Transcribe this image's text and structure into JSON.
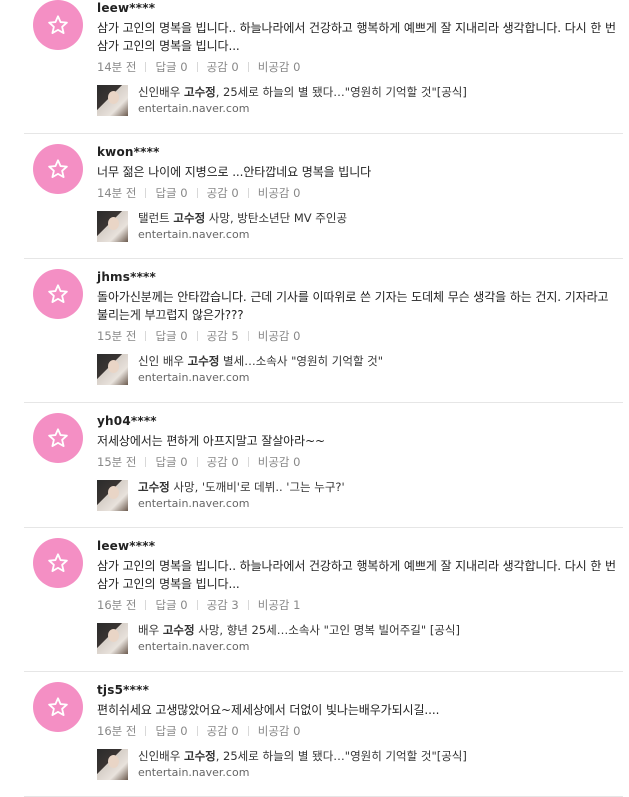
{
  "comments": [
    {
      "user": "leew****",
      "text": "삼가 고인의 명복을 빕니다.. 하늘나라에서 건강하고 행복하게 예쁘게 잘 지내리라 생각합니다. 다시 한 번 삼가 고인의 명복을 빕니다...",
      "time": "14분 전",
      "reply": "답글 0",
      "like": "공감 0",
      "dislike": "비공감 0",
      "article_pre": "신인배우 ",
      "article_name": "고수정",
      "article_post": ", 25세로 하늘의 별 됐다…\"영원히 기억할 것\"[공식]",
      "source": "entertain.naver.com"
    },
    {
      "user": "kwon****",
      "text": "너무 젊은 나이에 지병으로 ...안타깝네요 명복을 빕니다",
      "time": "14분 전",
      "reply": "답글 0",
      "like": "공감 0",
      "dislike": "비공감 0",
      "article_pre": "탤런트 ",
      "article_name": "고수정",
      "article_post": " 사망, 방탄소년단 MV 주인공",
      "source": "entertain.naver.com"
    },
    {
      "user": "jhms****",
      "text": "돌아가신분께는 안타깝습니다. 근데 기사를 이따위로 쓴 기자는 도데체 무슨 생각을 하는 건지. 기자라고 불리는게 부끄럽지 않은가???",
      "time": "15분 전",
      "reply": "답글 0",
      "like": "공감 5",
      "dislike": "비공감 0",
      "article_pre": "신인 배우 ",
      "article_name": "고수정",
      "article_post": " 별세…소속사 \"영원히 기억할 것\"",
      "source": "entertain.naver.com"
    },
    {
      "user": "yh04****",
      "text": "저세상에서는 편하게 아프지말고 잘살아라~~",
      "time": "15분 전",
      "reply": "답글 0",
      "like": "공감 0",
      "dislike": "비공감 0",
      "article_pre": "",
      "article_name": "고수정",
      "article_post": " 사망, '도깨비'로 데뷔.. '그는 누구?'",
      "source": "entertain.naver.com"
    },
    {
      "user": "leew****",
      "text": "삼가 고인의 명복을 빕니다.. 하늘나라에서 건강하고 행복하게 예쁘게 잘 지내리라 생각합니다. 다시 한 번 삼가 고인의 명복을 빕니다...",
      "time": "16분 전",
      "reply": "답글 0",
      "like": "공감 3",
      "dislike": "비공감 1",
      "article_pre": "배우 ",
      "article_name": "고수정",
      "article_post": " 사망, 향년 25세…소속사 \"고인 명복 빌어주길\" [공식]",
      "source": "entertain.naver.com"
    },
    {
      "user": "tjs5****",
      "text": "편히쉬세요 고생많았어요~제세상에서 더없이 빛나는배우가되시길....",
      "time": "16분 전",
      "reply": "답글 0",
      "like": "공감 0",
      "dislike": "비공감 0",
      "article_pre": "신인배우 ",
      "article_name": "고수정",
      "article_post": ", 25세로 하늘의 별 됐다…\"영원히 기억할 것\"[공식]",
      "source": "entertain.naver.com"
    }
  ]
}
